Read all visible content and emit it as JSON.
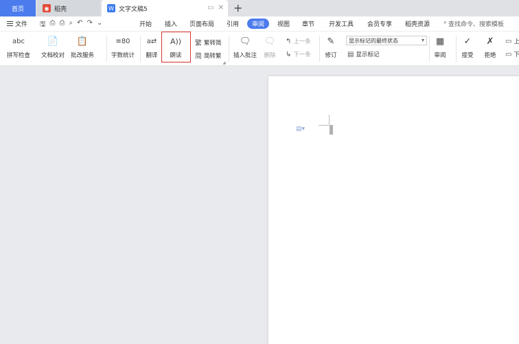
{
  "tabs": {
    "home": "首页",
    "daoke": "稻壳",
    "doc": "文字文稿5"
  },
  "menu": {
    "file": "文件",
    "items": [
      "开始",
      "插入",
      "页面布局",
      "引用",
      "审阅",
      "视图",
      "章节",
      "开发工具",
      "会员专享",
      "稻壳资源"
    ],
    "active": "审阅",
    "search": "查找命令、搜索模板"
  },
  "ribbon": {
    "spell_check": "拼写检查",
    "doc_proof": "文档校对",
    "batch_service": "批改服务",
    "word_count": "字数统计",
    "translate": "翻译",
    "read_aloud": "朗读",
    "trad_to_simp": "繁转简",
    "simp_to_trad": "简转繁",
    "insert_comment": "插入批注",
    "delete": "删除",
    "prev": "上一条",
    "next": "下一条",
    "track_changes": "修订",
    "markup_state": "显示标记的最终状态",
    "show_markup": "显示标记",
    "review": "审阅",
    "accept": "接受",
    "reject": "拒绝",
    "prev_short": "上",
    "next_short": "下"
  },
  "icons": {
    "spell": "abc",
    "read_aloud": "A))",
    "translate": "a⇄",
    "count": "≡80"
  },
  "colors": {
    "accent": "#4b7bec",
    "highlight": "#d9312b"
  }
}
